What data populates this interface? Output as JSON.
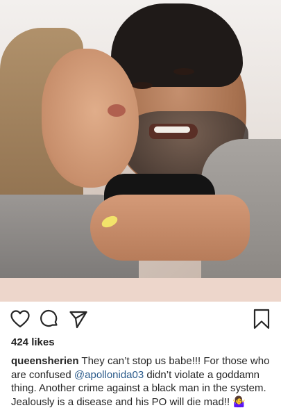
{
  "post": {
    "likes": "424 likes",
    "caption": {
      "username": "queensherien",
      "text_before_mention": " They can’t stop us babe!!! For those who are confused ",
      "mention": "@apollonida03",
      "text_after_mention": " didn’t violate a goddamn thing. Another crime against a black man in the system. Jealously is a disease and his PO will die mad!! ",
      "emoji": "🤷‍♀️"
    }
  },
  "actions": {
    "like_icon": "heart-icon",
    "comment_icon": "comment-icon",
    "share_icon": "share-icon",
    "save_icon": "bookmark-icon"
  },
  "colors": {
    "band": "#edd6cb",
    "text": "#262626",
    "mention": "#2a5a8a"
  }
}
